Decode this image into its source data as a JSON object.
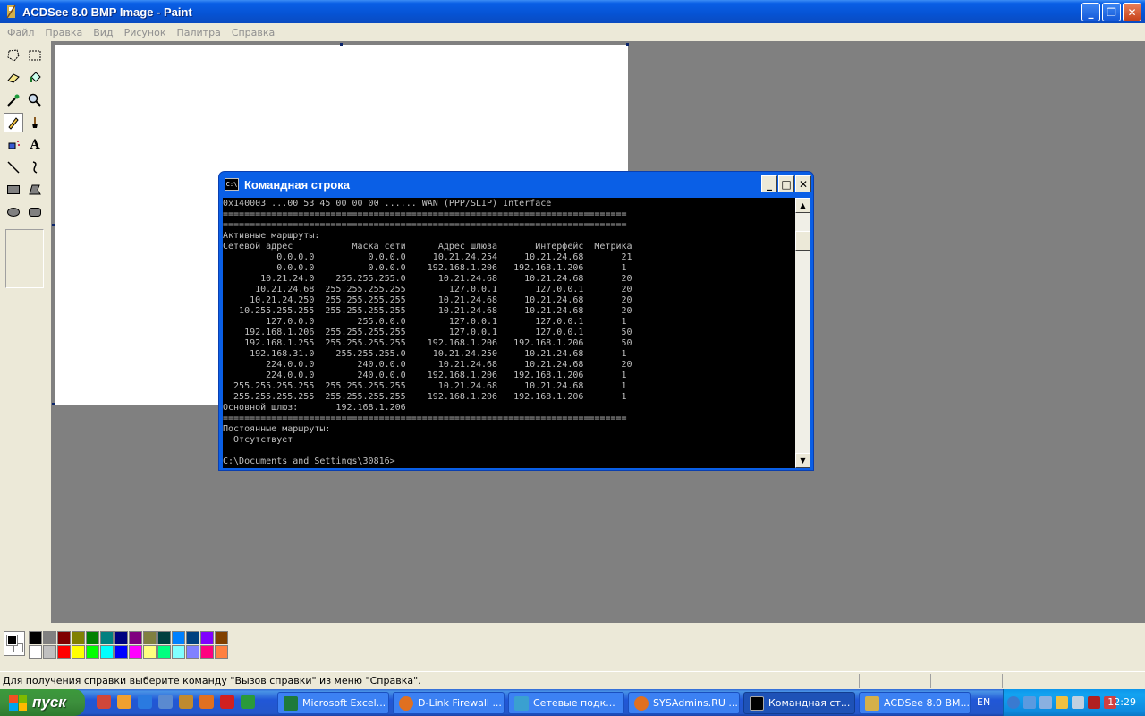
{
  "window": {
    "title": "ACDSee 8.0 BMP Image - Paint"
  },
  "menu": [
    "Файл",
    "Правка",
    "Вид",
    "Рисунок",
    "Палитра",
    "Справка"
  ],
  "tools": [
    "free-select",
    "rect-select",
    "eraser",
    "fill",
    "color-picker",
    "magnifier",
    "pencil",
    "brush",
    "airbrush",
    "text",
    "line",
    "curve",
    "rectangle",
    "polygon",
    "ellipse",
    "rounded-rectangle"
  ],
  "palette": {
    "top_row": [
      "#000000",
      "#808080",
      "#800000",
      "#808000",
      "#008000",
      "#008080",
      "#000080",
      "#800080",
      "#808040",
      "#004040",
      "#0080ff",
      "#004080",
      "#8000ff",
      "#804000"
    ],
    "bottom_row": [
      "#ffffff",
      "#c0c0c0",
      "#ff0000",
      "#ffff00",
      "#00ff00",
      "#00ffff",
      "#0000ff",
      "#ff00ff",
      "#ffff80",
      "#00ff80",
      "#80ffff",
      "#8080ff",
      "#ff0080",
      "#ff8040"
    ]
  },
  "status": {
    "text": "Для получения справки выберите команду \"Вызов справки\" из меню \"Справка\"."
  },
  "cmd": {
    "title": "Командная строка",
    "lines": [
      "0x140003 ...00 53 45 00 00 00 ...... WAN (PPP/SLIP) Interface",
      "===========================================================================",
      "===========================================================================",
      "Активные маршруты:",
      "Сетевой адрес           Маска сети      Адрес шлюза       Интерфейс  Метрика",
      "          0.0.0.0          0.0.0.0     10.21.24.254     10.21.24.68       21",
      "          0.0.0.0          0.0.0.0    192.168.1.206   192.168.1.206       1",
      "       10.21.24.0    255.255.255.0      10.21.24.68     10.21.24.68       20",
      "      10.21.24.68  255.255.255.255        127.0.0.1       127.0.0.1       20",
      "     10.21.24.250  255.255.255.255      10.21.24.68     10.21.24.68       20",
      "   10.255.255.255  255.255.255.255      10.21.24.68     10.21.24.68       20",
      "        127.0.0.0        255.0.0.0        127.0.0.1       127.0.0.1       1",
      "    192.168.1.206  255.255.255.255        127.0.0.1       127.0.0.1       50",
      "    192.168.1.255  255.255.255.255    192.168.1.206   192.168.1.206       50",
      "     192.168.31.0    255.255.255.0     10.21.24.250     10.21.24.68       1",
      "        224.0.0.0        240.0.0.0      10.21.24.68     10.21.24.68       20",
      "        224.0.0.0        240.0.0.0    192.168.1.206   192.168.1.206       1",
      "  255.255.255.255  255.255.255.255      10.21.24.68     10.21.24.68       1",
      "  255.255.255.255  255.255.255.255    192.168.1.206   192.168.1.206       1",
      "Основной шлюз:       192.168.1.206",
      "===========================================================================",
      "Постоянные маршруты:",
      "  Отсутствует",
      "",
      "C:\\Documents and Settings\\30816>"
    ]
  },
  "taskbar": {
    "start_label": "пуск",
    "tasks": [
      {
        "label": "Microsoft Excel..."
      },
      {
        "label": "D-Link Firewall ..."
      },
      {
        "label": "Сетевые подк..."
      },
      {
        "label": "SYSAdmins.RU ..."
      },
      {
        "label": "Командная ст..."
      },
      {
        "label": "ACDSee 8.0 BM..."
      }
    ],
    "lang": "EN",
    "clock": "12:29"
  }
}
